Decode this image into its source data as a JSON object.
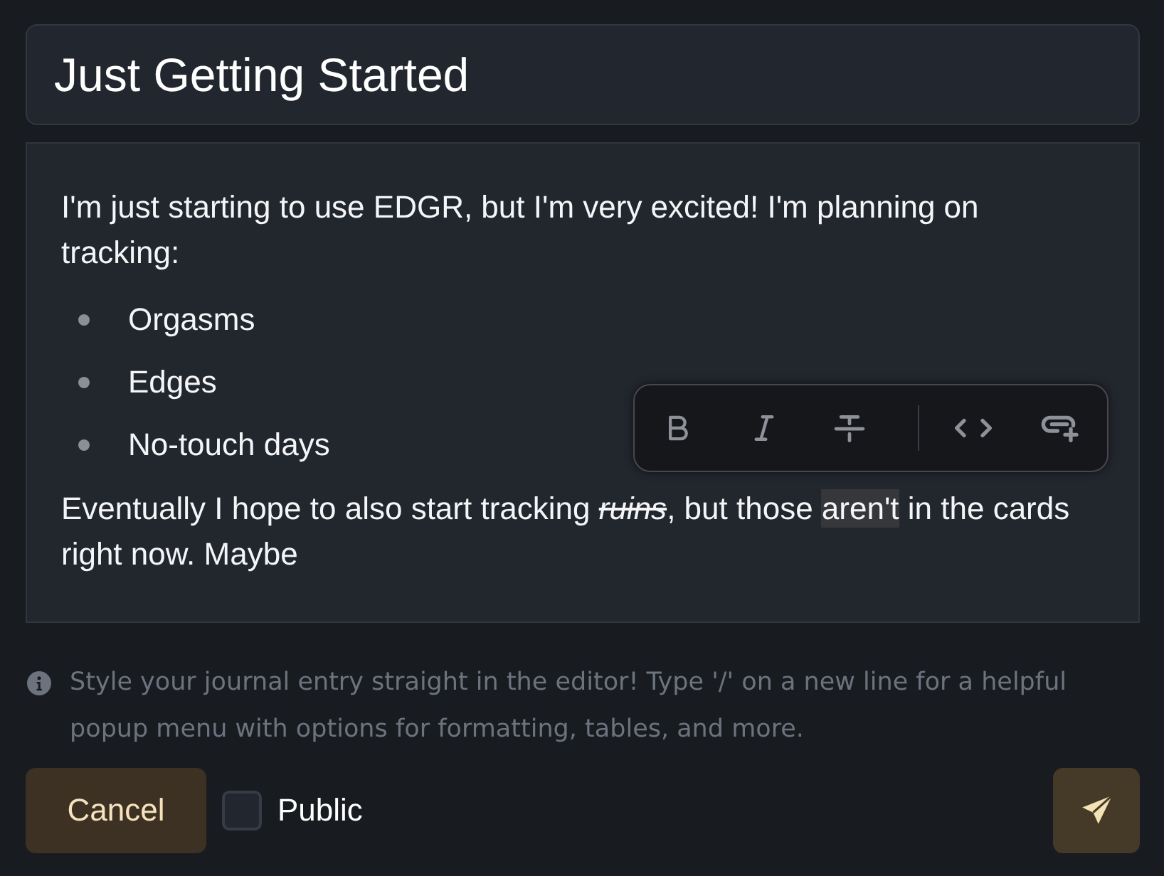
{
  "title_field": {
    "value": "Just Getting Started"
  },
  "editor": {
    "blocks": [
      {
        "kind": "paragraph",
        "segments": [
          {
            "text": "I'm just starting to use EDGR, but I'm very excited! I'm planning on tracking:",
            "italic": false,
            "strike": false,
            "selected": false
          }
        ]
      },
      {
        "kind": "bullet_list",
        "items": [
          "Orgasms",
          "Edges",
          "No-touch days"
        ]
      },
      {
        "kind": "paragraph",
        "segments": [
          {
            "text": "Eventually I hope to also start tracking ",
            "italic": false,
            "strike": false,
            "selected": false
          },
          {
            "text": "ruins",
            "italic": true,
            "strike": true,
            "selected": false
          },
          {
            "text": ", but those ",
            "italic": false,
            "strike": false,
            "selected": false
          },
          {
            "text": "aren't",
            "italic": false,
            "strike": false,
            "selected": true
          },
          {
            "text": " in the cards right now. Maybe",
            "italic": false,
            "strike": false,
            "selected": false
          }
        ]
      }
    ]
  },
  "hint": {
    "text": "Style your journal entry straight in the editor! Type '/' on a new line for a helpful popup menu with options for formatting, tables, and more."
  },
  "actions": {
    "cancel_button": {
      "label": "Cancel"
    },
    "public_checkbox": {
      "label": "Public",
      "checked": false
    }
  }
}
